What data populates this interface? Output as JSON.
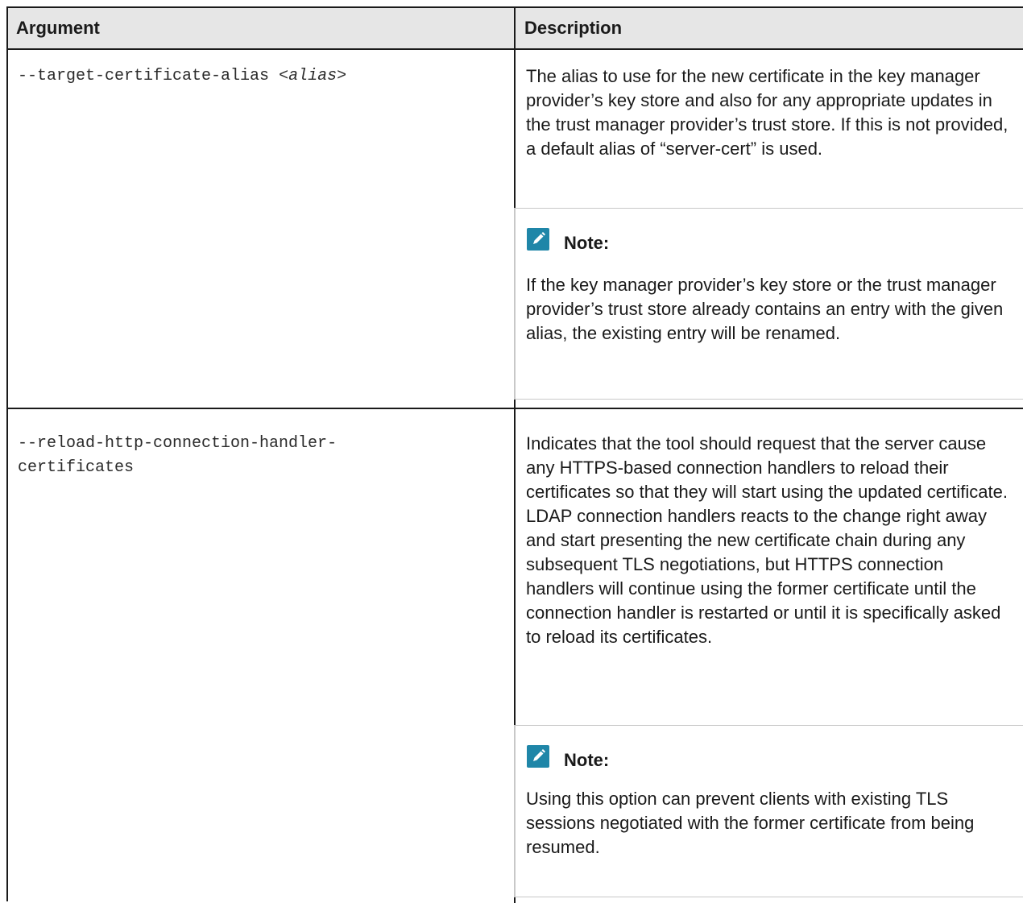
{
  "header": {
    "argument": "Argument",
    "description": "Description"
  },
  "rows": [
    {
      "argument_option": "--target-certificate-alias ",
      "argument_value": "<alias>",
      "description": "The alias to use for the new certificate in the key manager provider’s key store and also for any appropriate updates in the trust manager provider’s trust store. If this is not provided, a default alias of “server-cert” is used.",
      "note_title": "Note:",
      "note_text": "If the key manager provider’s key store or the trust manager provider’s trust store already contains an entry with the given alias, the existing entry will be renamed."
    },
    {
      "argument_line1": "--reload-http-connection-handler-",
      "argument_line2": "certificates",
      "description": "Indicates that the tool should request that the server cause any HTTPS-based connection handlers to reload their certificates so that they will start using the updated certificate. LDAP connection handlers reacts to the change right away and start presenting the new certificate chain during any subsequent TLS negotiations, but HTTPS connection handlers will continue using the former certificate until the connection handler is restarted or until it is specifically asked to reload its certificates.",
      "note_title": "Note:",
      "note_text": "Using this option can prevent clients with existing TLS sessions negotiated with the former certificate from being resumed."
    }
  ],
  "icons": {
    "note": "pencil-note-icon"
  },
  "colors": {
    "note_icon": "#1f86a8",
    "header_bg": "#e6e6e6"
  }
}
